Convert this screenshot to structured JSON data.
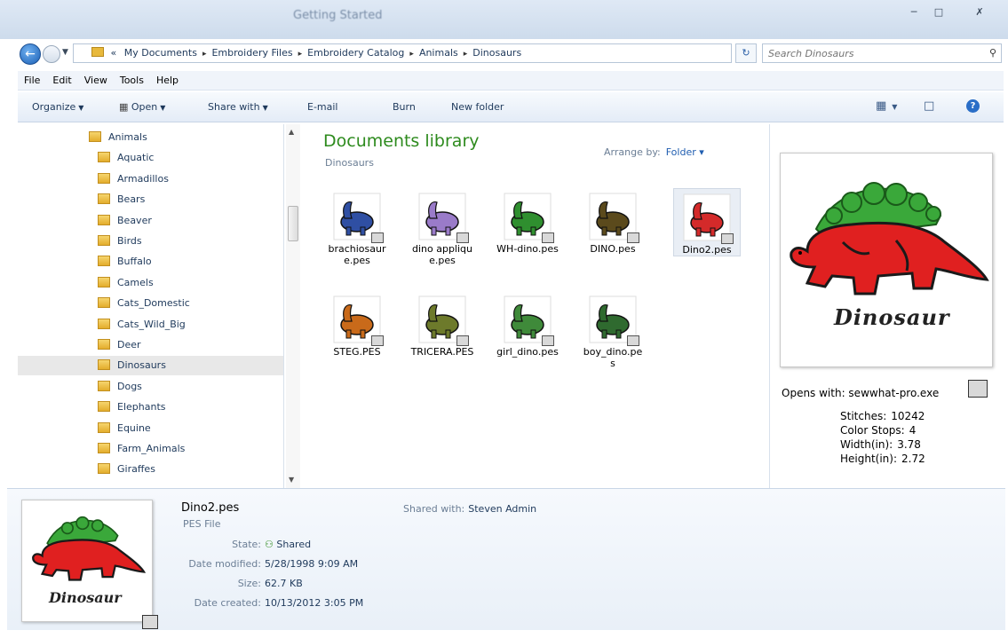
{
  "window": {
    "title": "Getting Started",
    "min_glyph": "─",
    "max_glyph": "□",
    "close_glyph": "✗"
  },
  "address": {
    "prefix": "«",
    "crumbs": [
      "My Documents",
      "Embroidery Files",
      "Embroidery Catalog",
      "Animals",
      "Dinosaurs"
    ],
    "separator": "▸",
    "search_placeholder": "Search Dinosaurs"
  },
  "menu": [
    "File",
    "Edit",
    "View",
    "Tools",
    "Help"
  ],
  "toolbar": {
    "organize": "Organize",
    "open": "Open",
    "share_with": "Share with",
    "email": "E-mail",
    "burn": "Burn",
    "new_folder": "New folder"
  },
  "nav": {
    "items": [
      {
        "label": "Animals",
        "depth": 0
      },
      {
        "label": "Aquatic",
        "depth": 1
      },
      {
        "label": "Armadillos",
        "depth": 1
      },
      {
        "label": "Bears",
        "depth": 1
      },
      {
        "label": "Beaver",
        "depth": 1
      },
      {
        "label": "Birds",
        "depth": 1
      },
      {
        "label": "Buffalo",
        "depth": 1
      },
      {
        "label": "Camels",
        "depth": 1
      },
      {
        "label": "Cats_Domestic",
        "depth": 1
      },
      {
        "label": "Cats_Wild_Big",
        "depth": 1
      },
      {
        "label": "Deer",
        "depth": 1
      },
      {
        "label": "Dinosaurs",
        "depth": 1,
        "selected": true
      },
      {
        "label": "Dogs",
        "depth": 1
      },
      {
        "label": "Elephants",
        "depth": 1
      },
      {
        "label": "Equine",
        "depth": 1
      },
      {
        "label": "Farm_Animals",
        "depth": 1
      },
      {
        "label": "Giraffes",
        "depth": 1
      }
    ]
  },
  "library": {
    "title": "Documents library",
    "subtitle": "Dinosaurs",
    "arrange_label": "Arrange by:",
    "arrange_value": "Folder ▾"
  },
  "files": [
    {
      "name": "brachiosaure.pes",
      "color": "#2f4fa3"
    },
    {
      "name": "dino applique.pes",
      "color": "#9a7bc9"
    },
    {
      "name": "WH-dino.pes",
      "color": "#2f8f2f"
    },
    {
      "name": "DINO.pes",
      "color": "#5b4a1c"
    },
    {
      "name": "Dino2.pes",
      "color": "#d42a2a",
      "selected": true
    },
    {
      "name": "STEG.PES",
      "color": "#c96a1a"
    },
    {
      "name": "TRICERA.PES",
      "color": "#6d7a2b"
    },
    {
      "name": "girl_dino.pes",
      "color": "#3f8a3a"
    },
    {
      "name": "boy_dino.pes",
      "color": "#2f6a2f"
    }
  ],
  "preview": {
    "opens_with": "Opens with: sewwhat-pro.exe",
    "art_label": "Dinosaur",
    "stats": [
      {
        "label": "Stitches:",
        "value": "10242"
      },
      {
        "label": "Color Stops:",
        "value": "4"
      },
      {
        "label": "Width(in):",
        "value": "3.78"
      },
      {
        "label": "Height(in):",
        "value": "2.72"
      }
    ]
  },
  "details": {
    "name": "Dino2.pes",
    "type": "PES File",
    "state_label": "State:",
    "state_value": "Shared",
    "modified_label": "Date modified:",
    "modified_value": "5/28/1998 9:09 AM",
    "size_label": "Size:",
    "size_value": "62.7 KB",
    "created_label": "Date created:",
    "created_value": "10/13/2012 3:05 PM",
    "shared_label": "Shared with:",
    "shared_value": "Steven Admin"
  },
  "colors": {
    "dino_red": "#e02020",
    "dino_green": "#3aa83a",
    "accent": "#1f5db0"
  }
}
